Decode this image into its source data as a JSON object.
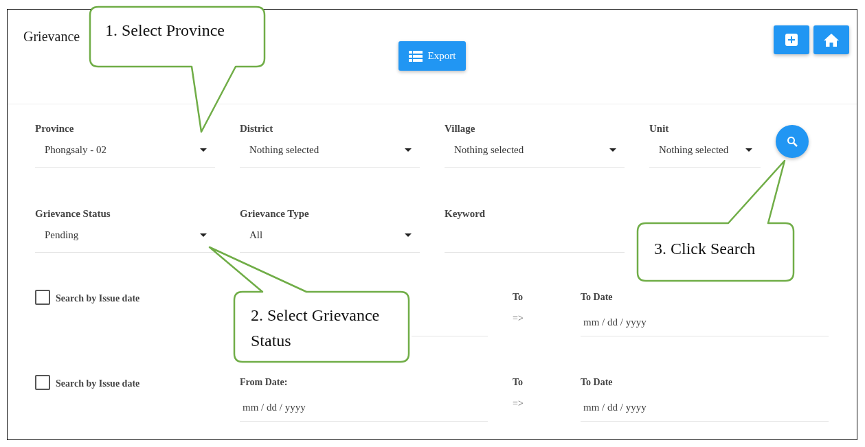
{
  "page_title": "Grievance",
  "export_button": {
    "label": "Export"
  },
  "filters": [
    {
      "kind": "select",
      "label": "Province",
      "value": "Phongsaly - 02"
    },
    {
      "kind": "select",
      "label": "District",
      "value": "Nothing selected"
    },
    {
      "kind": "select",
      "label": "Village",
      "value": "Nothing selected"
    },
    {
      "kind": "select",
      "label": "Unit",
      "value": "Nothing selected"
    },
    {
      "kind": "select",
      "label": "Grievance Status",
      "value": "Pending"
    },
    {
      "kind": "select",
      "label": "Grievance Type",
      "value": "All"
    },
    {
      "kind": "text",
      "label": "Keyword"
    }
  ],
  "date_rows": [
    {
      "checkbox_label": "Search by Issue date",
      "checked": false,
      "to_label": "To",
      "arrow": "=>",
      "to_date_label": "To Date",
      "to_placeholder": "mm / dd / yyyy"
    },
    {
      "checkbox_label": "Search by Issue date",
      "checked": false,
      "from_label": "From Date:",
      "from_placeholder": "mm / dd / yyyy",
      "to_label": "To",
      "arrow": "=>",
      "to_date_label": "To Date",
      "to_placeholder": "mm / dd / yyyy"
    }
  ],
  "callouts": [
    {
      "text": "1. Select Province"
    },
    {
      "text": "2. Select Grievance Status"
    },
    {
      "text": "3. Click Search"
    }
  ]
}
